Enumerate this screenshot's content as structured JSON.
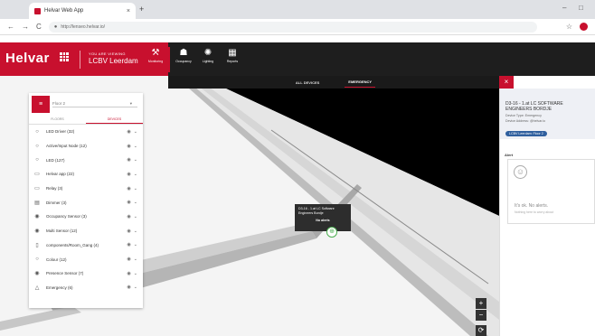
{
  "browser": {
    "tab_title": "Helvar Web App",
    "tab_close": "×",
    "new_tab": "+",
    "url": "http://lenseo.helvar.io/",
    "back": "←",
    "forward": "→",
    "reload": "C",
    "minimize": "–",
    "maximize": "□"
  },
  "app": {
    "logo": "Helvar",
    "site_small": "YOU ARE VIEWING",
    "site_name": "LCBV Leerdam",
    "nav": [
      {
        "label": "Monitoring",
        "icon": "⚒"
      },
      {
        "label": "Occupancy",
        "icon": "☗"
      },
      {
        "label": "Lighting",
        "icon": "✺"
      },
      {
        "label": "Reports",
        "icon": "▦"
      }
    ]
  },
  "subtabs": [
    "ALL DEVICES",
    "EMERGENCY"
  ],
  "panel": {
    "menu_icon": "≡",
    "floor": "Floor 2",
    "floor_caret": "▾",
    "tabs": [
      "FLOORS",
      "DEVICES"
    ],
    "devices": [
      {
        "name": "LED Driver (32)",
        "icon": "○"
      },
      {
        "name": "Active/Input Node (12)",
        "icon": "○"
      },
      {
        "name": "LED (127)",
        "icon": "○"
      },
      {
        "name": "Helvar app (22)",
        "icon": "▭"
      },
      {
        "name": "Relay (3)",
        "icon": "▭"
      },
      {
        "name": "Dimmer (3)",
        "icon": "▤"
      },
      {
        "name": "Occupancy Sensor (3)",
        "icon": "◉"
      },
      {
        "name": "Multi Sensor (12)",
        "icon": "◉"
      },
      {
        "name": "components/Room_Gang (4)",
        "icon": "▯"
      },
      {
        "name": "Colour (12)",
        "icon": "○"
      },
      {
        "name": "Presence Sensor (7)",
        "icon": "◉"
      },
      {
        "name": "Emergency (6)",
        "icon": "△"
      }
    ],
    "eye_icon": "◉",
    "chevron": "⌄"
  },
  "tooltip": {
    "title": "D3-16 - 1.at LC Software Engineers Bordje",
    "status": "No alerts"
  },
  "marker_icon": "⊕",
  "zoom": {
    "in": "+",
    "out": "−",
    "reset": "⟳"
  },
  "detail": {
    "close": "×",
    "title": "D3-16 - 1.at LC SOFTWARE ENGINEERS BORDJE",
    "device_type": "Device Type: Emergency",
    "device_address": "Device Address: @helvar.io",
    "site_chip": "LCBV Leerdam: Floor 2",
    "alert_label": "Alert",
    "no_alerts": "It's ok. No alerts.",
    "no_alerts_sub": "Nothing here to worry about",
    "smile_icon": "☺"
  },
  "colors": {
    "brand": "#c8102e",
    "dark": "#1e1e1e",
    "ok": "#4caf50"
  }
}
